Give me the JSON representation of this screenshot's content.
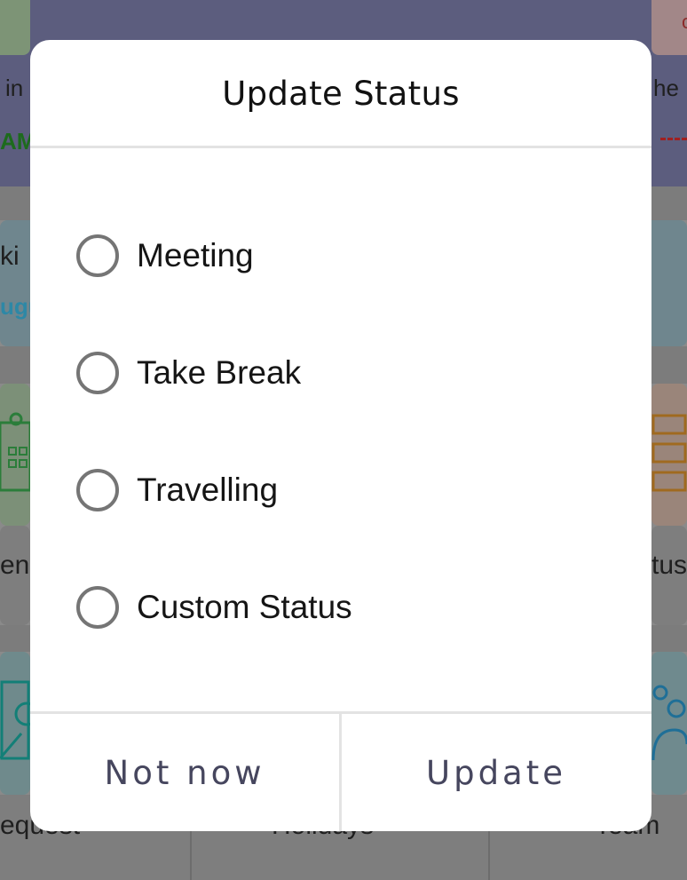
{
  "background": {
    "header_left_text": "in",
    "header_left_time": "AM",
    "header_right_text": "he",
    "header_right_glyph": "c",
    "section_left_text": "ki",
    "section_left_sub": "ugu",
    "row1_left_label": "en",
    "row1_right_label": "tus",
    "footer": {
      "left_label": "equest",
      "middle_label": "Holidays",
      "right_label": "Team"
    }
  },
  "dialog": {
    "title": "Update Status",
    "options": [
      {
        "label": "Meeting",
        "selected": false
      },
      {
        "label": "Take Break",
        "selected": false
      },
      {
        "label": "Travelling",
        "selected": false
      },
      {
        "label": "Custom Status",
        "selected": false
      }
    ],
    "cancel_label": "Not now",
    "confirm_label": "Update"
  },
  "colors": {
    "radio_border": "#757575",
    "button_text": "#46465e",
    "scrim_header": "#5c5d7e"
  },
  "icons": [
    "calendar-icon",
    "list-icon",
    "request-icon",
    "team-icon"
  ]
}
